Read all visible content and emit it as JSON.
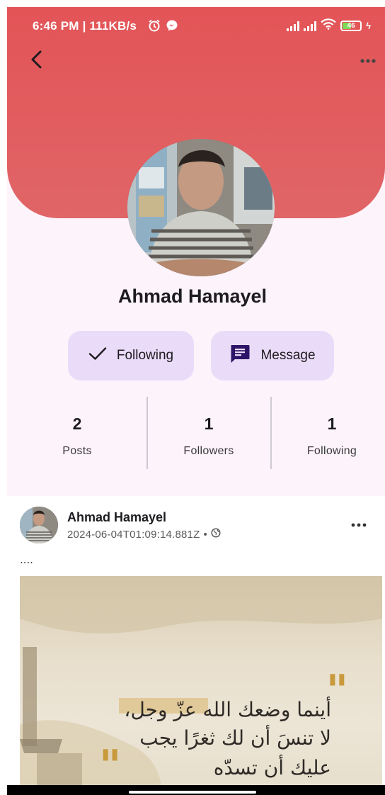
{
  "status_bar": {
    "time": "6:46 PM | 111KB/s",
    "battery": "46"
  },
  "profile": {
    "name": "Ahmad Hamayel",
    "following_button": "Following",
    "message_button": "Message",
    "stats": [
      {
        "value": "2",
        "label": "Posts"
      },
      {
        "value": "1",
        "label": "Followers"
      },
      {
        "value": "1",
        "label": "Following"
      }
    ]
  },
  "post": {
    "author": "Ahmad Hamayel",
    "timestamp": "2024-06-04T01:09:14.881Z",
    "separator": "•",
    "text": "....",
    "image_quote": [
      "أينما وضعك الله عزّ وجل،",
      "لا تنسَ أن لك ثغرًا يجب",
      "عليك أن تسدّه"
    ]
  },
  "colors": {
    "header_red": "#e35457",
    "profile_background": "#fdf3fb",
    "button_background": "#eadcf9",
    "message_icon": "#2e1468"
  },
  "icons": {
    "back": "arrow-back-icon",
    "more": "more-horizontal-icon",
    "following": "check-icon",
    "message": "chat-bubble-icon",
    "privacy": "globe-icon"
  }
}
